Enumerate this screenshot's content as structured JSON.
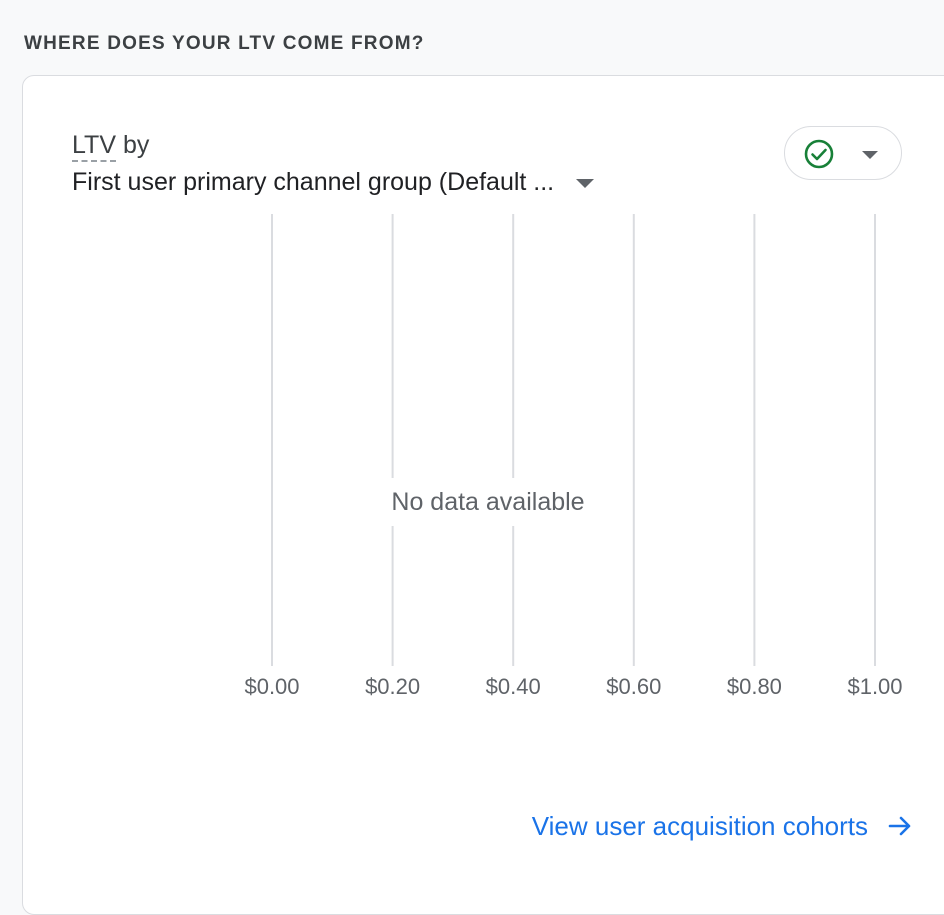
{
  "section": {
    "title": "WHERE DOES YOUR LTV COME FROM?"
  },
  "card": {
    "metric_label": "LTV",
    "metric_suffix": "by",
    "dimension_label": "First user primary channel group (Default ...",
    "status_icon": "check-circle-icon",
    "no_data_message": "No data available",
    "link_label": "View user acquisition cohorts",
    "link_icon": "arrow-right-icon"
  },
  "colors": {
    "status_green": "#188038",
    "link_blue": "#1a73e8",
    "gridline": "#dadce0"
  },
  "chart_data": {
    "type": "bar",
    "orientation": "horizontal",
    "categories": [],
    "values": [],
    "xlim": [
      0,
      1
    ],
    "x_ticks": [
      0,
      0.2,
      0.4,
      0.6,
      0.8,
      1.0
    ],
    "x_tick_labels": [
      "$0.00",
      "$0.20",
      "$0.40",
      "$0.60",
      "$0.80",
      "$1.00"
    ],
    "grid": true,
    "title": "",
    "xlabel": "",
    "ylabel": ""
  }
}
